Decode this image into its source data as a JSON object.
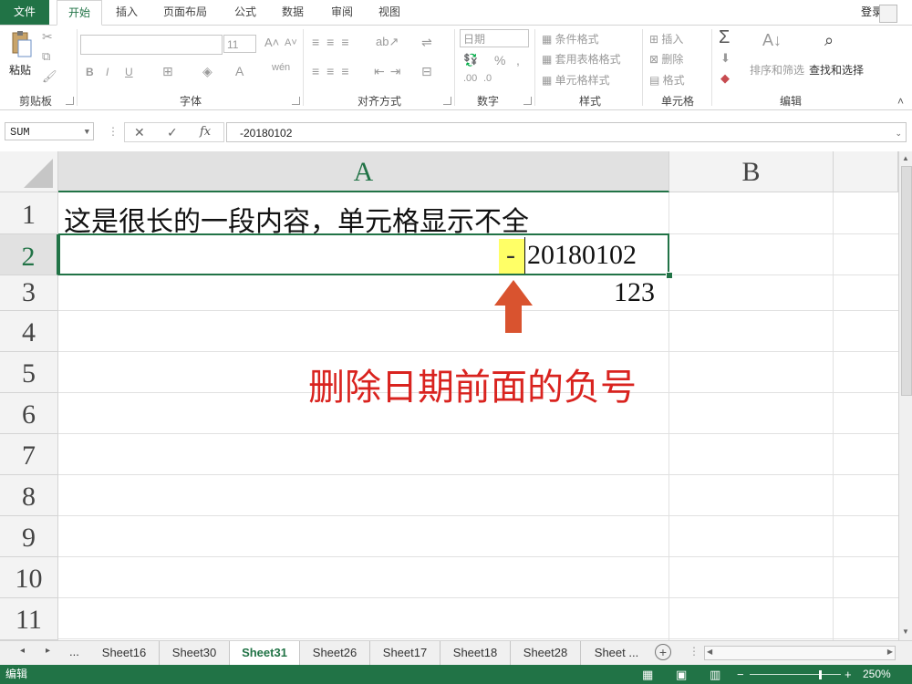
{
  "tabs": {
    "file": "文件",
    "items": [
      "开始",
      "插入",
      "页面布局",
      "公式",
      "数据",
      "审阅",
      "视图"
    ],
    "active_index": 0,
    "login": "登录"
  },
  "ribbon": {
    "clipboard": {
      "paste": "粘贴",
      "label": "剪贴板"
    },
    "font": {
      "size": "11",
      "label": "字体"
    },
    "alignment": {
      "label": "对齐方式"
    },
    "number": {
      "format": "日期",
      "label": "数字"
    },
    "styles": {
      "conditional": "条件格式",
      "table": "套用表格格式",
      "cell": "单元格样式",
      "label": "样式"
    },
    "cells": {
      "insert": "插入",
      "delete": "删除",
      "format": "格式",
      "label": "单元格"
    },
    "editing": {
      "sort": "排序和筛选",
      "find": "查找和选择",
      "label": "编辑"
    }
  },
  "formula_bar": {
    "name_box": "SUM",
    "formula": "-20180102"
  },
  "sheet": {
    "columns": [
      "A",
      "B"
    ],
    "rows": [
      "1",
      "2",
      "3",
      "4",
      "5",
      "6",
      "7",
      "8",
      "9",
      "10",
      "11"
    ],
    "cells": {
      "A1": "这是很长的一段内容，单元格显示不全",
      "A2_minus": "-",
      "A2_value": "20180102",
      "A3": "123"
    },
    "annotation": "删除日期前面的负号"
  },
  "sheet_tabs": {
    "ellipsis": "...",
    "items": [
      "Sheet16",
      "Sheet30",
      "Sheet31",
      "Sheet26",
      "Sheet17",
      "Sheet18",
      "Sheet28",
      "Sheet ..."
    ],
    "active_index": 2
  },
  "status": {
    "mode": "编辑",
    "zoom": "250%"
  },
  "colors": {
    "accent": "#217346",
    "annotation": "#d9231f",
    "highlight": "#ffff66"
  }
}
